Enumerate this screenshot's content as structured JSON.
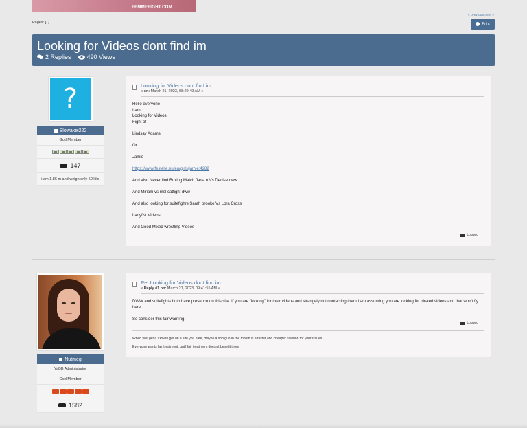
{
  "banner": {
    "text": "FEMMEFIGHT.COM"
  },
  "nav": {
    "previous": "« previous",
    "next": "next »"
  },
  "pages": {
    "label": "Pages:",
    "value": "[1]"
  },
  "toolbar": {
    "print_label": "Print"
  },
  "topic": {
    "title": "Looking for Videos dont find im",
    "replies": "2 Replies",
    "views": "490 Views"
  },
  "posts": [
    {
      "author": {
        "name": "Slowakei222",
        "rank": "God Member",
        "post_count": "147",
        "personal_text": "i am 1.86 m and weigh only 50 kilo",
        "avatar": "question-mark"
      },
      "title": "Looking for Videos dont find im",
      "meta_prefix": "« on:",
      "meta_date": "March 21, 2023, 08:29:49 AM »",
      "body": {
        "intro": [
          "Hello everyone",
          "I am",
          "Looking for Videos",
          "Fight of"
        ],
        "p1": "Lindsay Adams",
        "p2": "Or",
        "p3": "Jamie",
        "link": "https://www.festelle.eu/en/girls/jamie:4282",
        "p4": "And also Never find Boxing Match Jana n Vs Denise dww",
        "p5": "And Miriam vs mel catfight  dww",
        "p6": "And also looking for suitefighrs Sarah brooke Vs Lora Cross",
        "p7": "Ladyfist Videos",
        "p8": "And Good Mixed wrestling Videos"
      },
      "logged": "Logged"
    },
    {
      "author": {
        "name": "Nutmeg",
        "position": "YaBB Administrator",
        "rank": "God Member",
        "post_count": "1582",
        "avatar": "photo"
      },
      "title": "Re: Looking for Videos dont find im",
      "meta_prefix": "« Reply #1 on:",
      "meta_date": "March 21, 2023, 09:41:55 AM »",
      "body": {
        "p1": "DWW and suitefights both have presence on this site. If you are \"looking\" for their videos and strangely not contacting them I am assuming you are looking for pirated videos and that won't fly here.",
        "p2": "So consider this fair warning."
      },
      "logged": "Logged",
      "signature": [
        "When you get a VPN to get on a site you hate, maybe a shotgun in the mouth is a faster and cheaper solution for your issues.",
        "Everyone wants fair treatment, until fair treatment doesn't benefit them"
      ]
    }
  ],
  "colors": {
    "header": "#4b6b8f",
    "link": "#4b77a8",
    "avatar_bg": "#1eb0e1",
    "star_red": "#d9491c"
  }
}
